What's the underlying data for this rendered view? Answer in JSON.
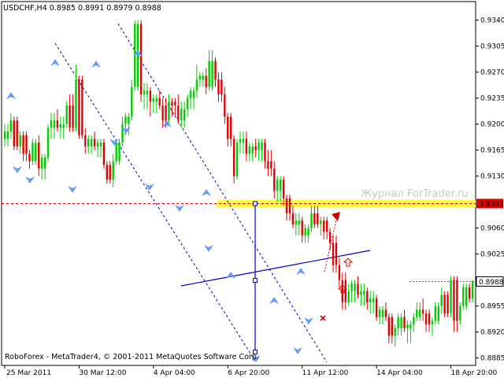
{
  "chart_data": {
    "type": "candlestick",
    "symbol_header": "USDCHF,H4  0.8985 0.8991 0.8979 0.8988",
    "watermark": "Журнал ForTrader.ru",
    "footer": "RoboForex - MetaTrader4, © 2001-2011 MetaQuotes Software Corp.",
    "ylim": [
      0.8875,
      0.9365
    ],
    "y_ticks": [
      "0.9340",
      "0.9305",
      "0.9270",
      "0.9235",
      "0.9200",
      "0.9165",
      "0.9130",
      "0.9060",
      "0.9025",
      "0.8955",
      "0.8920",
      "0.8885"
    ],
    "y_tick_values": [
      0.934,
      0.9305,
      0.927,
      0.9235,
      0.92,
      0.9165,
      0.913,
      0.906,
      0.9025,
      0.8955,
      0.892,
      0.8885
    ],
    "x_tick_labels": [
      "25 Mar 2011",
      "30 Mar 12:00",
      "4 Apr 04:00",
      "6 Apr 20:00",
      "11 Apr 12:00",
      "14 Apr 04:00",
      "18 Apr 20:00"
    ],
    "x_tick_index": [
      0,
      24,
      48,
      72,
      96,
      120,
      144
    ],
    "n_bars": 152,
    "current_price": "0.8988",
    "target_level": "0.9093",
    "candles": [
      [
        0.918,
        0.92,
        0.917,
        0.919
      ],
      [
        0.919,
        0.9215,
        0.918,
        0.9205
      ],
      [
        0.9205,
        0.921,
        0.9165,
        0.917
      ],
      [
        0.917,
        0.919,
        0.916,
        0.9185
      ],
      [
        0.9185,
        0.919,
        0.915,
        0.916
      ],
      [
        0.916,
        0.9165,
        0.914,
        0.915
      ],
      [
        0.915,
        0.918,
        0.9145,
        0.9175
      ],
      [
        0.9175,
        0.9185,
        0.913,
        0.914
      ],
      [
        0.914,
        0.916,
        0.9125,
        0.9155
      ],
      [
        0.9155,
        0.92,
        0.915,
        0.9195
      ],
      [
        0.9195,
        0.9215,
        0.918,
        0.9205
      ],
      [
        0.9205,
        0.922,
        0.919,
        0.9195
      ],
      [
        0.9195,
        0.921,
        0.918,
        0.92
      ],
      [
        0.92,
        0.923,
        0.9195,
        0.9225
      ],
      [
        0.9225,
        0.924,
        0.919,
        0.9195
      ],
      [
        0.9195,
        0.928,
        0.919,
        0.926
      ],
      [
        0.926,
        0.9265,
        0.918,
        0.9185
      ],
      [
        0.9185,
        0.9195,
        0.916,
        0.917
      ],
      [
        0.917,
        0.9185,
        0.916,
        0.918
      ],
      [
        0.918,
        0.919,
        0.9165,
        0.917
      ],
      [
        0.917,
        0.918,
        0.9155,
        0.9175
      ],
      [
        0.9175,
        0.918,
        0.914,
        0.9145
      ],
      [
        0.9145,
        0.915,
        0.912,
        0.9125
      ],
      [
        0.9125,
        0.916,
        0.9115,
        0.915
      ],
      [
        0.915,
        0.918,
        0.9145,
        0.9175
      ],
      [
        0.9175,
        0.921,
        0.917,
        0.92
      ],
      [
        0.92,
        0.9215,
        0.9185,
        0.921
      ],
      [
        0.921,
        0.926,
        0.9205,
        0.925
      ],
      [
        0.925,
        0.934,
        0.9245,
        0.9335
      ],
      [
        0.9335,
        0.934,
        0.923,
        0.924
      ],
      [
        0.924,
        0.9255,
        0.922,
        0.9245
      ],
      [
        0.9245,
        0.925,
        0.921,
        0.923
      ],
      [
        0.923,
        0.924,
        0.9215,
        0.9235
      ],
      [
        0.9235,
        0.9245,
        0.922,
        0.9225
      ],
      [
        0.9225,
        0.9235,
        0.9195,
        0.9205
      ],
      [
        0.9205,
        0.924,
        0.92,
        0.923
      ],
      [
        0.923,
        0.9235,
        0.921,
        0.9225
      ],
      [
        0.9225,
        0.924,
        0.92,
        0.9205
      ],
      [
        0.9205,
        0.923,
        0.9195,
        0.922
      ],
      [
        0.922,
        0.924,
        0.921,
        0.9235
      ],
      [
        0.9235,
        0.925,
        0.922,
        0.9245
      ],
      [
        0.9245,
        0.928,
        0.9235,
        0.926
      ],
      [
        0.926,
        0.927,
        0.925,
        0.9265
      ],
      [
        0.9265,
        0.9275,
        0.924,
        0.925
      ],
      [
        0.925,
        0.93,
        0.9245,
        0.9285
      ],
      [
        0.9285,
        0.929,
        0.925,
        0.926
      ],
      [
        0.926,
        0.927,
        0.923,
        0.924
      ],
      [
        0.924,
        0.925,
        0.92,
        0.921
      ],
      [
        0.921,
        0.9215,
        0.917,
        0.918
      ],
      [
        0.918,
        0.9185,
        0.912,
        0.913
      ],
      [
        0.913,
        0.918,
        0.9125,
        0.9175
      ],
      [
        0.9175,
        0.919,
        0.916,
        0.918
      ],
      [
        0.918,
        0.919,
        0.915,
        0.916
      ],
      [
        0.916,
        0.9175,
        0.915,
        0.917
      ],
      [
        0.917,
        0.918,
        0.9155,
        0.9165
      ],
      [
        0.9165,
        0.918,
        0.915,
        0.9175
      ],
      [
        0.9175,
        0.918,
        0.914,
        0.915
      ],
      [
        0.915,
        0.9165,
        0.913,
        0.914
      ],
      [
        0.914,
        0.915,
        0.91,
        0.911
      ],
      [
        0.911,
        0.913,
        0.9095,
        0.9125
      ],
      [
        0.9125,
        0.913,
        0.909,
        0.91
      ],
      [
        0.91,
        0.9105,
        0.907,
        0.908
      ],
      [
        0.908,
        0.909,
        0.906,
        0.9065
      ],
      [
        0.9065,
        0.908,
        0.905,
        0.907
      ],
      [
        0.907,
        0.9075,
        0.904,
        0.905
      ],
      [
        0.905,
        0.9065,
        0.904,
        0.906
      ],
      [
        0.906,
        0.909,
        0.9055,
        0.908
      ],
      [
        0.908,
        0.909,
        0.906,
        0.9065
      ],
      [
        0.9065,
        0.9075,
        0.905,
        0.907
      ],
      [
        0.907,
        0.9075,
        0.9045,
        0.9055
      ],
      [
        0.9055,
        0.906,
        0.903,
        0.904
      ],
      [
        0.904,
        0.905,
        0.9,
        0.901
      ],
      [
        0.901,
        0.902,
        0.898,
        0.899
      ],
      [
        0.899,
        0.9,
        0.895,
        0.896
      ],
      [
        0.896,
        0.8985,
        0.8955,
        0.8975
      ],
      [
        0.8975,
        0.899,
        0.896,
        0.8985
      ],
      [
        0.8985,
        0.8995,
        0.8965,
        0.897
      ],
      [
        0.897,
        0.8985,
        0.8955,
        0.8975
      ],
      [
        0.8975,
        0.898,
        0.895,
        0.896
      ],
      [
        0.896,
        0.8975,
        0.8945,
        0.8965
      ],
      [
        0.8965,
        0.897,
        0.8935,
        0.894
      ],
      [
        0.894,
        0.8955,
        0.893,
        0.895
      ],
      [
        0.895,
        0.896,
        0.8935,
        0.894
      ],
      [
        0.894,
        0.8945,
        0.8905,
        0.8915
      ],
      [
        0.8915,
        0.893,
        0.89,
        0.8925
      ],
      [
        0.8925,
        0.8945,
        0.8915,
        0.894
      ],
      [
        0.894,
        0.895,
        0.892,
        0.8925
      ],
      [
        0.8925,
        0.8935,
        0.8905,
        0.893
      ],
      [
        0.893,
        0.8945,
        0.892,
        0.894
      ],
      [
        0.894,
        0.896,
        0.8935,
        0.895
      ],
      [
        0.895,
        0.8965,
        0.8935,
        0.8945
      ],
      [
        0.8945,
        0.895,
        0.892,
        0.893
      ],
      [
        0.893,
        0.894,
        0.8915,
        0.8935
      ],
      [
        0.8935,
        0.896,
        0.893,
        0.8955
      ],
      [
        0.8955,
        0.898,
        0.8945,
        0.897
      ],
      [
        0.897,
        0.8975,
        0.894,
        0.8945
      ],
      [
        0.8945,
        0.8995,
        0.894,
        0.899
      ],
      [
        0.899,
        0.8995,
        0.892,
        0.8935
      ],
      [
        0.8935,
        0.896,
        0.893,
        0.8955
      ],
      [
        0.8955,
        0.8985,
        0.895,
        0.898
      ],
      [
        0.898,
        0.8985,
        0.896,
        0.8965
      ],
      [
        0.8965,
        0.899,
        0.896,
        0.8988
      ]
    ]
  }
}
